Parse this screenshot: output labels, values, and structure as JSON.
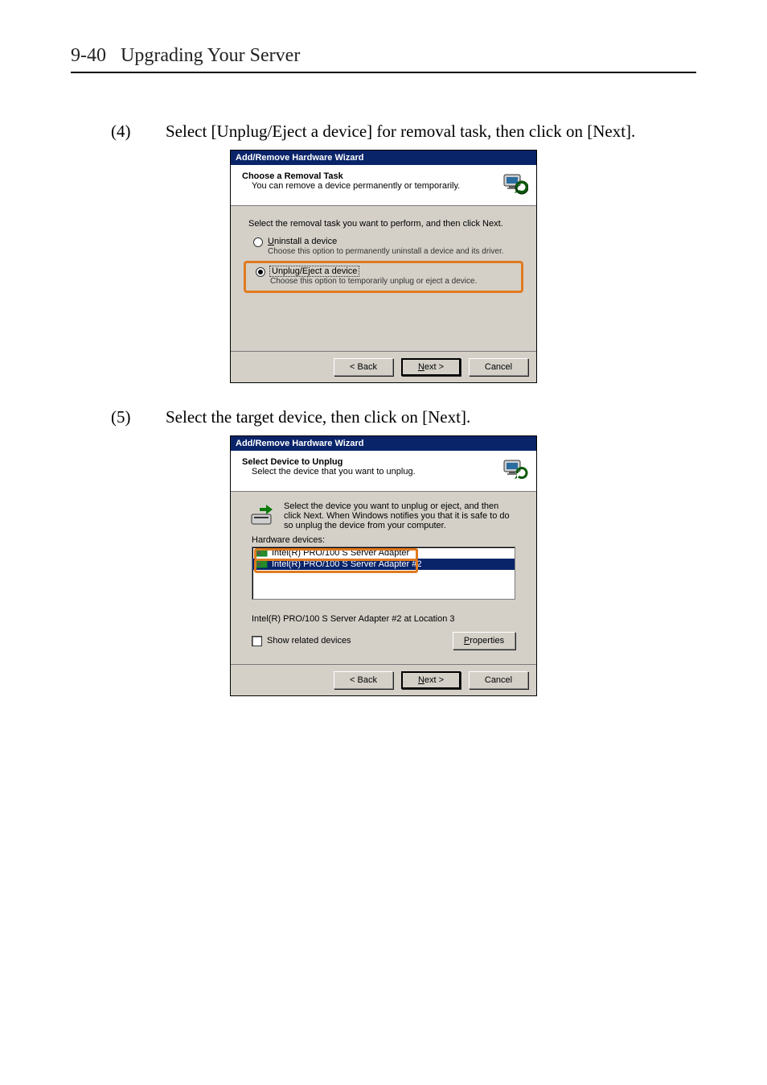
{
  "header": {
    "pagenum": "9-40",
    "section": "Upgrading Your Server"
  },
  "step4": {
    "num": "(4)",
    "text": "Select [Unplug/Eject a device] for removal task, then click on [Next]."
  },
  "step5": {
    "num": "(5)",
    "text": "Select the target device, then click on [Next]."
  },
  "dlg1": {
    "title": "Add/Remove Hardware Wizard",
    "h1": "Choose a Removal Task",
    "h2": "You can remove a device permanently or temporarily.",
    "prompt": "Select the removal task you want to perform, and then click Next.",
    "opt1_pre": "U",
    "opt1_rest": "ninstall a device",
    "opt1_desc": "Choose this option to permanently uninstall a device and its driver.",
    "opt2_label": "Unplug/Eject a device",
    "opt2_desc": "Choose this option to temporarily unplug or eject a device.",
    "back": "< Back",
    "next_pre": "N",
    "next_rest": "ext >",
    "cancel": "Cancel"
  },
  "dlg2": {
    "title": "Add/Remove Hardware Wizard",
    "h1": "Select Device to Unplug",
    "h2": "Select the device that you want to unplug.",
    "info": "Select the device you want to unplug or eject, and then click Next. When Windows notifies you that it is safe to do so unplug the device from your computer.",
    "list_label": "Hardware devices:",
    "item1": "Intel(R) PRO/100 S Server Adapter",
    "item2": "Intel(R) PRO/100 S Server Adapter #2",
    "path": "Intel(R) PRO/100 S Server Adapter #2 at Location 3",
    "show_related": "Show related devices",
    "props_pre": "P",
    "props_rest": "roperties",
    "back": "< Back",
    "next_pre": "N",
    "next_rest": "ext >",
    "cancel": "Cancel"
  }
}
